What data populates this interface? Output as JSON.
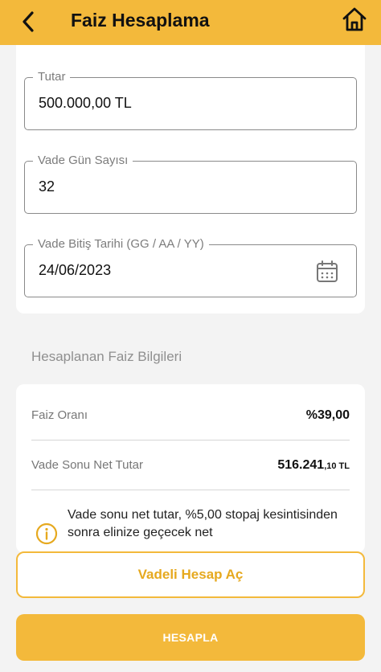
{
  "header": {
    "title": "Faiz Hesaplama",
    "back_icon": "chevron-left-icon",
    "home_icon": "home-icon"
  },
  "form": {
    "amount": {
      "label": "Tutar",
      "value": "500.000,00 TL"
    },
    "days": {
      "label": "Vade Gün Sayısı",
      "value": "32"
    },
    "end_date": {
      "label": "Vade Bitiş Tarihi (GG / AA / YY)",
      "value": "24/06/2023",
      "icon": "calendar-icon"
    }
  },
  "results": {
    "title": "Hesaplanan Faiz Bilgileri",
    "rate": {
      "label": "Faiz Oranı",
      "value": "%39,00"
    },
    "net": {
      "label": "Vade Sonu Net Tutar",
      "value_main": "516.241",
      "value_fraction": ",10 TL"
    },
    "note": "Vade sonu net tutar, %5,00 stopaj kesintisinden sonra elinize geçecek net",
    "note_icon": "info-icon"
  },
  "buttons": {
    "open_account": "Vadeli Hesap Aç",
    "calculate": "HESAPLA"
  },
  "colors": {
    "accent": "#f3b93b",
    "accent_text": "#e6a91f",
    "background": "#f3f3f3"
  }
}
